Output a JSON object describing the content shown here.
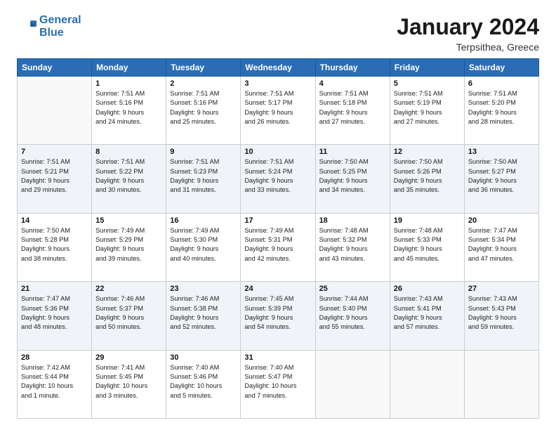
{
  "logo": {
    "line1": "General",
    "line2": "Blue"
  },
  "header": {
    "month": "January 2024",
    "location": "Terpsithea, Greece"
  },
  "days_of_week": [
    "Sunday",
    "Monday",
    "Tuesday",
    "Wednesday",
    "Thursday",
    "Friday",
    "Saturday"
  ],
  "weeks": [
    [
      {
        "day": "",
        "info": ""
      },
      {
        "day": "1",
        "info": "Sunrise: 7:51 AM\nSunset: 5:16 PM\nDaylight: 9 hours\nand 24 minutes."
      },
      {
        "day": "2",
        "info": "Sunrise: 7:51 AM\nSunset: 5:16 PM\nDaylight: 9 hours\nand 25 minutes."
      },
      {
        "day": "3",
        "info": "Sunrise: 7:51 AM\nSunset: 5:17 PM\nDaylight: 9 hours\nand 26 minutes."
      },
      {
        "day": "4",
        "info": "Sunrise: 7:51 AM\nSunset: 5:18 PM\nDaylight: 9 hours\nand 27 minutes."
      },
      {
        "day": "5",
        "info": "Sunrise: 7:51 AM\nSunset: 5:19 PM\nDaylight: 9 hours\nand 27 minutes."
      },
      {
        "day": "6",
        "info": "Sunrise: 7:51 AM\nSunset: 5:20 PM\nDaylight: 9 hours\nand 28 minutes."
      }
    ],
    [
      {
        "day": "7",
        "info": "Sunrise: 7:51 AM\nSunset: 5:21 PM\nDaylight: 9 hours\nand 29 minutes."
      },
      {
        "day": "8",
        "info": "Sunrise: 7:51 AM\nSunset: 5:22 PM\nDaylight: 9 hours\nand 30 minutes."
      },
      {
        "day": "9",
        "info": "Sunrise: 7:51 AM\nSunset: 5:23 PM\nDaylight: 9 hours\nand 31 minutes."
      },
      {
        "day": "10",
        "info": "Sunrise: 7:51 AM\nSunset: 5:24 PM\nDaylight: 9 hours\nand 33 minutes."
      },
      {
        "day": "11",
        "info": "Sunrise: 7:50 AM\nSunset: 5:25 PM\nDaylight: 9 hours\nand 34 minutes."
      },
      {
        "day": "12",
        "info": "Sunrise: 7:50 AM\nSunset: 5:26 PM\nDaylight: 9 hours\nand 35 minutes."
      },
      {
        "day": "13",
        "info": "Sunrise: 7:50 AM\nSunset: 5:27 PM\nDaylight: 9 hours\nand 36 minutes."
      }
    ],
    [
      {
        "day": "14",
        "info": "Sunrise: 7:50 AM\nSunset: 5:28 PM\nDaylight: 9 hours\nand 38 minutes."
      },
      {
        "day": "15",
        "info": "Sunrise: 7:49 AM\nSunset: 5:29 PM\nDaylight: 9 hours\nand 39 minutes."
      },
      {
        "day": "16",
        "info": "Sunrise: 7:49 AM\nSunset: 5:30 PM\nDaylight: 9 hours\nand 40 minutes."
      },
      {
        "day": "17",
        "info": "Sunrise: 7:49 AM\nSunset: 5:31 PM\nDaylight: 9 hours\nand 42 minutes."
      },
      {
        "day": "18",
        "info": "Sunrise: 7:48 AM\nSunset: 5:32 PM\nDaylight: 9 hours\nand 43 minutes."
      },
      {
        "day": "19",
        "info": "Sunrise: 7:48 AM\nSunset: 5:33 PM\nDaylight: 9 hours\nand 45 minutes."
      },
      {
        "day": "20",
        "info": "Sunrise: 7:47 AM\nSunset: 5:34 PM\nDaylight: 9 hours\nand 47 minutes."
      }
    ],
    [
      {
        "day": "21",
        "info": "Sunrise: 7:47 AM\nSunset: 5:36 PM\nDaylight: 9 hours\nand 48 minutes."
      },
      {
        "day": "22",
        "info": "Sunrise: 7:46 AM\nSunset: 5:37 PM\nDaylight: 9 hours\nand 50 minutes."
      },
      {
        "day": "23",
        "info": "Sunrise: 7:46 AM\nSunset: 5:38 PM\nDaylight: 9 hours\nand 52 minutes."
      },
      {
        "day": "24",
        "info": "Sunrise: 7:45 AM\nSunset: 5:39 PM\nDaylight: 9 hours\nand 54 minutes."
      },
      {
        "day": "25",
        "info": "Sunrise: 7:44 AM\nSunset: 5:40 PM\nDaylight: 9 hours\nand 55 minutes."
      },
      {
        "day": "26",
        "info": "Sunrise: 7:43 AM\nSunset: 5:41 PM\nDaylight: 9 hours\nand 57 minutes."
      },
      {
        "day": "27",
        "info": "Sunrise: 7:43 AM\nSunset: 5:43 PM\nDaylight: 9 hours\nand 59 minutes."
      }
    ],
    [
      {
        "day": "28",
        "info": "Sunrise: 7:42 AM\nSunset: 5:44 PM\nDaylight: 10 hours\nand 1 minute."
      },
      {
        "day": "29",
        "info": "Sunrise: 7:41 AM\nSunset: 5:45 PM\nDaylight: 10 hours\nand 3 minutes."
      },
      {
        "day": "30",
        "info": "Sunrise: 7:40 AM\nSunset: 5:46 PM\nDaylight: 10 hours\nand 5 minutes."
      },
      {
        "day": "31",
        "info": "Sunrise: 7:40 AM\nSunset: 5:47 PM\nDaylight: 10 hours\nand 7 minutes."
      },
      {
        "day": "",
        "info": ""
      },
      {
        "day": "",
        "info": ""
      },
      {
        "day": "",
        "info": ""
      }
    ]
  ]
}
